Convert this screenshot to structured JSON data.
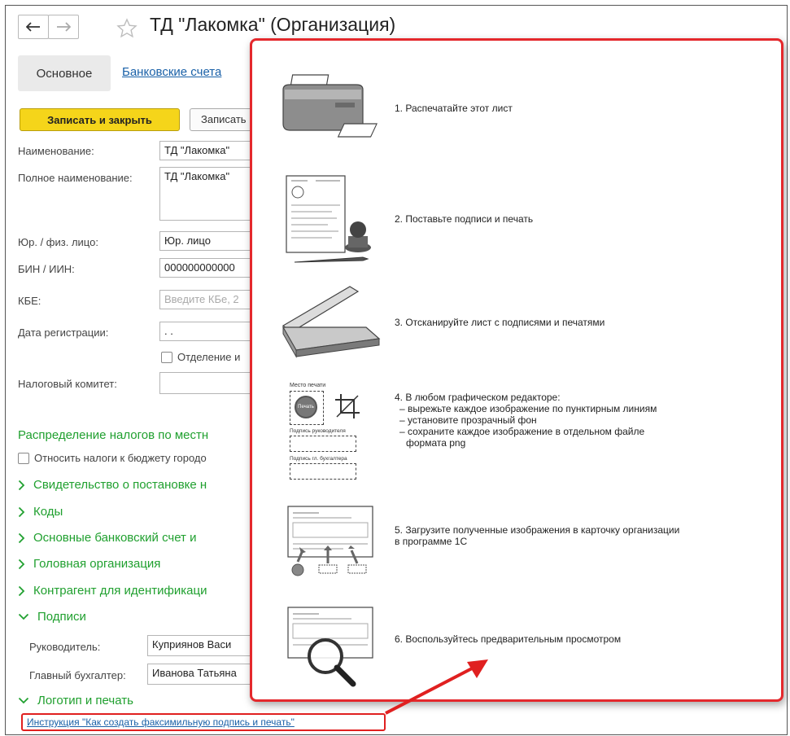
{
  "window": {
    "title": "ТД \"Лакомка\" (Организация)",
    "back_icon": "arrow-left-icon",
    "forward_icon": "arrow-right-icon",
    "favorite_icon": "star-icon"
  },
  "tabs": {
    "main": "Основное",
    "bank": "Банковские счета"
  },
  "toolbar": {
    "save_close": "Записать и закрыть",
    "save": "Записать"
  },
  "form": {
    "name_label": "Наименование:",
    "name_value": "ТД \"Лакомка\"",
    "full_name_label": "Полное наименование:",
    "full_name_value": "ТД \"Лакомка\"",
    "entity_type_label": "Юр. / физ. лицо:",
    "entity_type_value": "Юр. лицо",
    "bin_label": "БИН / ИИН:",
    "bin_value": "000000000000",
    "kbe_label": "КБЕ:",
    "kbe_placeholder": "Введите КБе, 2",
    "reg_date_label": "Дата регистрации:",
    "reg_date_value": " .  .",
    "branch_checkbox_label": "Отделение и",
    "tax_committee_label": "Налоговый комитет:"
  },
  "tax_section": {
    "title": "Распределение налогов по местн",
    "checkbox_label": "Относить налоги к бюджету городо"
  },
  "groups": [
    {
      "label": "Свидетельство о постановке н",
      "expanded": false
    },
    {
      "label": "Коды",
      "expanded": false
    },
    {
      "label": "Основные банковский счет и",
      "expanded": false
    },
    {
      "label": "Головная организация",
      "expanded": false
    },
    {
      "label": "Контрагент для идентификаци",
      "expanded": false
    },
    {
      "label": "Подписи",
      "expanded": true
    },
    {
      "label": "Логотип и печать",
      "expanded": true
    }
  ],
  "signatures": {
    "director_label": "Руководитель:",
    "director_value": "Куприянов Васи",
    "accountant_label": "Главный бухгалтер:",
    "accountant_value": "Иванова Татьяна"
  },
  "instruction_link": "Инструкция \"Как создать факсимильную подпись и печать\"",
  "popup": {
    "steps": [
      {
        "text": "1. Распечатайте этот лист",
        "icon": "printer-icon"
      },
      {
        "text": "2. Поставьте подписи и печать",
        "icon": "stamp-document-icon"
      },
      {
        "text": "3. Отсканируйте лист с подписями и печатями",
        "icon": "scanner-icon"
      },
      {
        "text": "4. В любом графическом редакторе:",
        "icon": "crop-icon",
        "sub": [
          "– вырежьте каждое изображение по пунктирным линиям",
          "– установите прозрачный фон",
          "– сохраните каждое изображение в отдельном файле",
          "формата png"
        ],
        "illus_labels": [
          "Место печати",
          "Подпись руководителя",
          "Подпись гл. бухгалтера"
        ],
        "stamp_text": "Печать"
      },
      {
        "text": "5. Загрузите полученные изображения в карточку организации",
        "text2": "в программе 1С",
        "icon": "upload-document-icon"
      },
      {
        "text": "6. Воспользуйтесь предварительным просмотром",
        "icon": "magnifier-icon"
      }
    ]
  },
  "colors": {
    "accent_green": "#20a02f",
    "link_blue": "#1a61a8",
    "primary_button": "#f5d51a",
    "highlight_red": "#e02020"
  }
}
